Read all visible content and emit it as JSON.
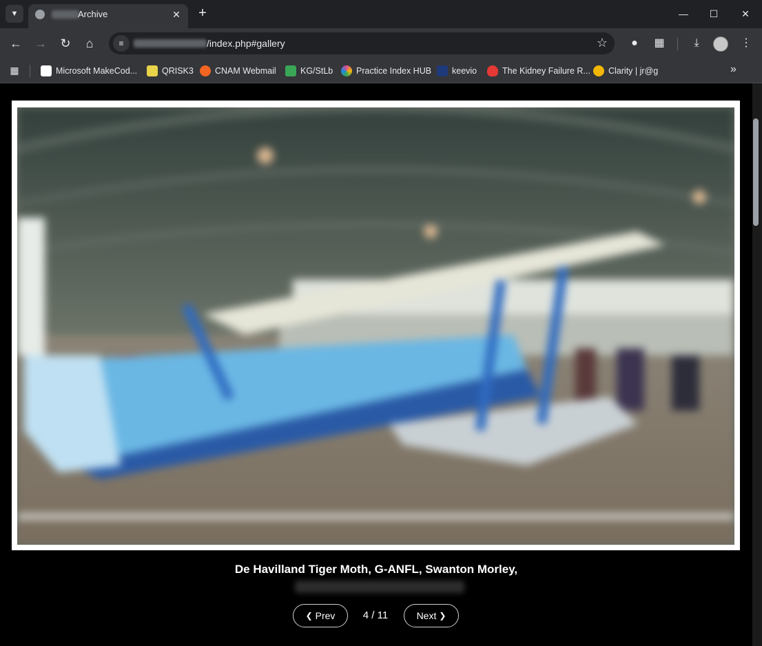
{
  "browser": {
    "tab": {
      "title": "Archive"
    },
    "address": {
      "url_visible": "/index.php#gallery"
    },
    "bookmarks": [
      {
        "label": "Microsoft MakeCod...",
        "color": "#ffffff"
      },
      {
        "label": "QRISK3",
        "color": "#e8d24a"
      },
      {
        "label": "CNAM Webmail",
        "color": "#f26522"
      },
      {
        "label": "KG/StLb",
        "color": "#3aa655"
      },
      {
        "label": "Practice Index HUB",
        "color": "#e34c8b"
      },
      {
        "label": "keevio",
        "color": "#1f3a7a"
      },
      {
        "label": "The Kidney Failure R...",
        "color": "#e53935"
      },
      {
        "label": "Clarity | jr@g",
        "color": "#f2b705"
      }
    ]
  },
  "gallery": {
    "caption": "De Havilland Tiger Moth, G-ANFL, Swanton Morley,",
    "prev_label": "Prev",
    "next_label": "Next",
    "counter": "4 / 11"
  }
}
